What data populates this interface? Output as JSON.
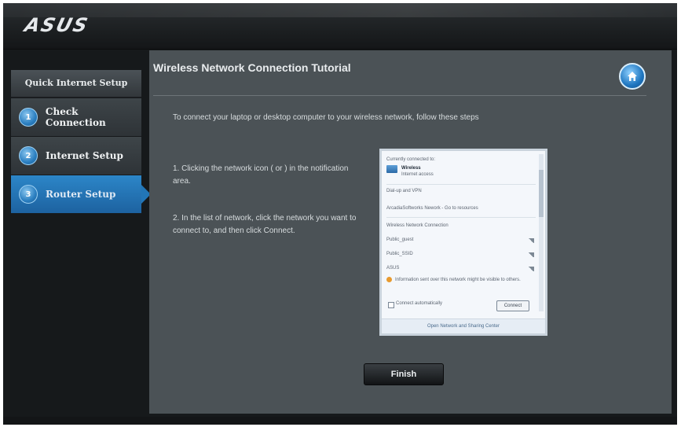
{
  "brand": {
    "logo": "ASUS"
  },
  "sidebar": {
    "title": "Quick Internet Setup",
    "items": [
      {
        "number": "1",
        "label": "Check Connection",
        "active": false
      },
      {
        "number": "2",
        "label": "Internet Setup",
        "active": false
      },
      {
        "number": "3",
        "label": "Router Setup",
        "active": true
      }
    ]
  },
  "main": {
    "title": "Wireless Network Connection Tutorial",
    "home_icon": "home-icon",
    "intro": "To connect your laptop or desktop computer to your wireless network, follow these steps",
    "step1": "1. Clicking the network icon ( or ) in the notification area.",
    "step2": "2. In the list of network, click the network you want to connect to, and then click Connect.",
    "finish_label": "Finish"
  },
  "popup": {
    "currently_connected": "Currently connected to:",
    "network_name": "Wireless",
    "network_status": "Internet access",
    "dialup_header": "Dial-up and VPN",
    "vpn_entry": "ArcadiaSoftworks Nework - Go to resources",
    "wireless_header": "Wireless Network Connection",
    "networks": [
      "Public_guest",
      "Public_SSID",
      "ASUS"
    ],
    "warning": "Information sent over this network might be visible to others.",
    "connect_auto": "Connect automatically",
    "connect_label": "Connect",
    "footer": "Open Network and Sharing Center"
  },
  "colors": {
    "accent": "#2276b7",
    "panel": "#4b5256",
    "background": "#16191b"
  }
}
